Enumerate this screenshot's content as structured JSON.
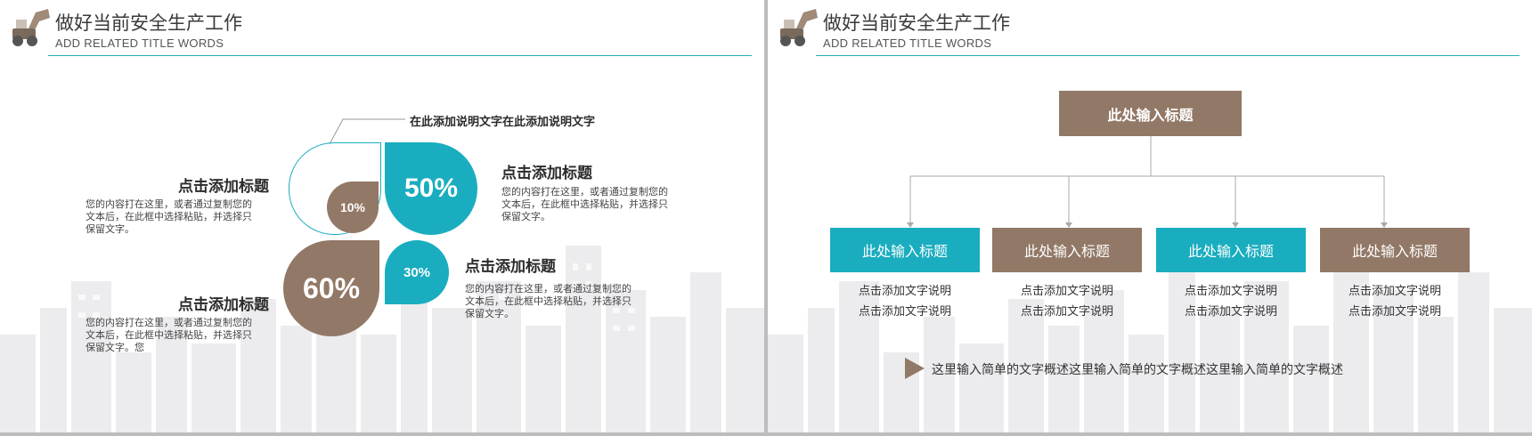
{
  "header": {
    "title_cn": "做好当前安全生产工作",
    "title_en": "ADD RELATED TITLE WORDS"
  },
  "colors": {
    "teal": "#19adbf",
    "brown": "#927866",
    "rule": "#27aeb9"
  },
  "left_slide": {
    "callout": "在此添加说明文字在此添加说明文字",
    "petals": {
      "p10": "10%",
      "p50": "50%",
      "p30": "30%",
      "p60": "60%"
    },
    "block_top_left": {
      "heading": "点击添加标题",
      "text": [
        "您的内容打在这里，或者通过复制您的",
        "文本后，在此框中选择粘贴，并选择只",
        "保留文字。"
      ]
    },
    "block_bottom_left": {
      "heading": "点击添加标题",
      "text": [
        "您的内容打在这里，或者通过复制您的",
        "文本后，在此框中选择粘贴，并选择只",
        "保留文字。您"
      ]
    },
    "block_top_right": {
      "heading": "点击添加标题",
      "text": [
        "您的内容打在这里，或者通过复制您的",
        "文本后，在此框中选择粘贴，并选择只",
        "保留文字。"
      ]
    },
    "block_mid_right": {
      "heading": "点击添加标题",
      "text": [
        "您的内容打在这里，或者通过复制您的",
        "文本后，在此框中选择粘贴，并选择只",
        "保留文字。"
      ]
    }
  },
  "right_slide": {
    "top_box": "此处输入标题",
    "boxes": [
      {
        "label": "此处输入标题",
        "lines": [
          "点击添加文字说明",
          "点击添加文字说明"
        ]
      },
      {
        "label": "此处输入标题",
        "lines": [
          "点击添加文字说明",
          "点击添加文字说明"
        ]
      },
      {
        "label": "此处输入标题",
        "lines": [
          "点击添加文字说明",
          "点击添加文字说明"
        ]
      },
      {
        "label": "此处输入标题",
        "lines": [
          "点击添加文字说明",
          "点击添加文字说明"
        ]
      }
    ],
    "summary": "这里输入简单的文字概述这里输入简单的文字概述这里输入简单的文字概述"
  }
}
